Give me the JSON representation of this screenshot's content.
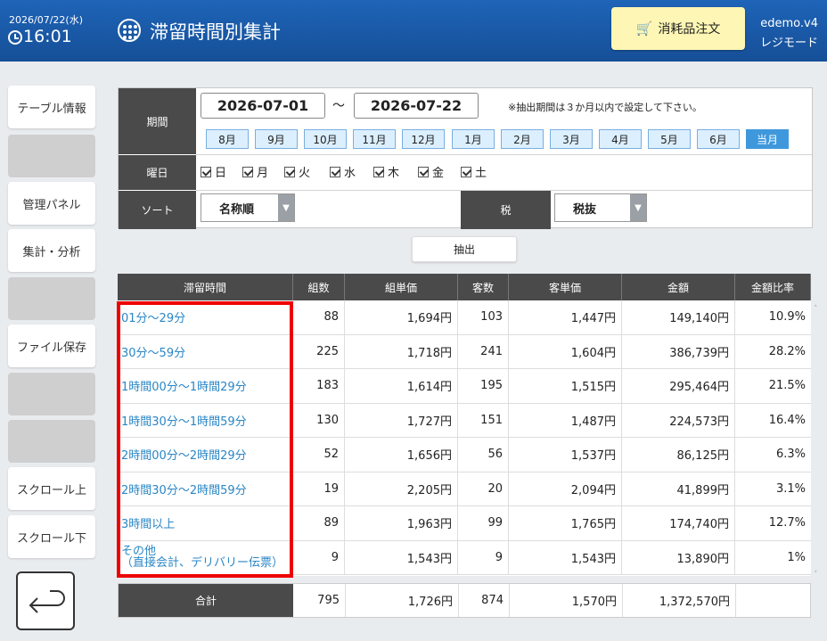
{
  "header": {
    "date": "2026/07/22(水)",
    "time": "16:01",
    "title": "滞留時間別集計",
    "order_button": "消耗品注文",
    "version": "edemo.v4",
    "mode": "レジモード"
  },
  "sidebar": {
    "items": [
      "テーブル情報",
      "",
      "管理パネル",
      "集計・分析",
      "",
      "ファイル保存",
      "",
      "",
      "スクロール上",
      "スクロール下"
    ]
  },
  "filter": {
    "period_label": "期間",
    "date_from": "2026-07-01",
    "date_to": "2026-07-22",
    "tilde": "～",
    "note": "※抽出期間は３か月以内で設定して下さい。",
    "months": [
      "8月",
      "9月",
      "10月",
      "11月",
      "12月",
      "1月",
      "2月",
      "3月",
      "4月",
      "5月",
      "6月",
      "当月"
    ],
    "active_month": "当月",
    "weekday_label": "曜日",
    "weekdays": [
      "日",
      "月",
      "火",
      "水",
      "木",
      "金",
      "土"
    ],
    "sort_label": "ソート",
    "sort_value": "名称順",
    "tax_label": "税",
    "tax_value": "税抜",
    "extract_button": "抽出"
  },
  "table": {
    "headers": [
      "滞留時間",
      "組数",
      "組単価",
      "客数",
      "客単価",
      "金額",
      "金額比率"
    ],
    "rows": [
      [
        "01分～29分",
        "88",
        "1,694円",
        "103",
        "1,447円",
        "149,140円",
        "10.9%"
      ],
      [
        "30分～59分",
        "225",
        "1,718円",
        "241",
        "1,604円",
        "386,739円",
        "28.2%"
      ],
      [
        "1時間00分～1時間29分",
        "183",
        "1,614円",
        "195",
        "1,515円",
        "295,464円",
        "21.5%"
      ],
      [
        "1時間30分～1時間59分",
        "130",
        "1,727円",
        "151",
        "1,487円",
        "224,573円",
        "16.4%"
      ],
      [
        "2時間00分～2時間29分",
        "52",
        "1,656円",
        "56",
        "1,537円",
        "86,125円",
        "6.3%"
      ],
      [
        "2時間30分～2時間59分",
        "19",
        "2,205円",
        "20",
        "2,094円",
        "41,899円",
        "3.1%"
      ],
      [
        "3時間以上",
        "89",
        "1,963円",
        "99",
        "1,765円",
        "174,740円",
        "12.7%"
      ],
      [
        "その他",
        "9",
        "1,543円",
        "9",
        "1,543円",
        "13,890円",
        "1%"
      ]
    ],
    "other_sub": "（直接会計、デリバリー伝票）",
    "total": {
      "label": "合計",
      "values": [
        "795",
        "1,726円",
        "874",
        "1,570円",
        "1,372,570円",
        ""
      ]
    }
  },
  "colors": {
    "header_blue": "#1a5aab",
    "accent_blue": "#3f98dc",
    "highlight_red": "#e00000",
    "order_yellow": "#fdf6b4"
  }
}
